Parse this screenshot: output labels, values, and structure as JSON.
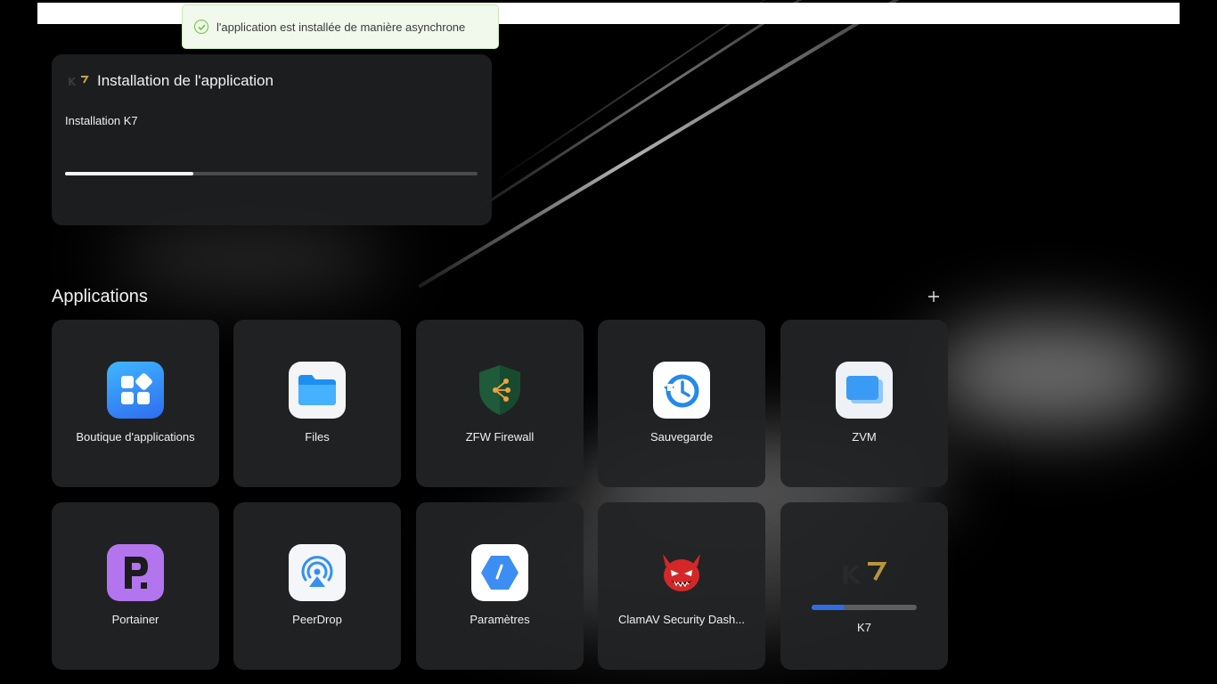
{
  "toast": {
    "message": "l'application est installée de manière asynchrone",
    "icon": "check-circle-icon",
    "color": "#67c23a"
  },
  "install_card": {
    "title": "Installation de l'application",
    "app_logo": "K7",
    "subtitle": "Installation K7",
    "progress_fraction": 0.31
  },
  "applications": {
    "heading": "Applications",
    "add_icon": "plus-icon",
    "items": [
      {
        "label": "Boutique d'applications",
        "icon": "app-store-icon"
      },
      {
        "label": "Files",
        "icon": "folder-icon"
      },
      {
        "label": "ZFW Firewall",
        "icon": "shield-icon"
      },
      {
        "label": "Sauvegarde",
        "icon": "backup-clock-icon"
      },
      {
        "label": "ZVM",
        "icon": "zvm-windows-icon"
      },
      {
        "label": "Portainer",
        "icon": "portainer-icon"
      },
      {
        "label": "PeerDrop",
        "icon": "peerdrop-icon"
      },
      {
        "label": "Paramètres",
        "icon": "settings-icon"
      },
      {
        "label": "ClamAV Security Dash...",
        "icon": "clamav-devil-icon"
      },
      {
        "label": "K7",
        "icon": "k7-logo-icon",
        "progress_fraction": 0.31
      }
    ]
  }
}
